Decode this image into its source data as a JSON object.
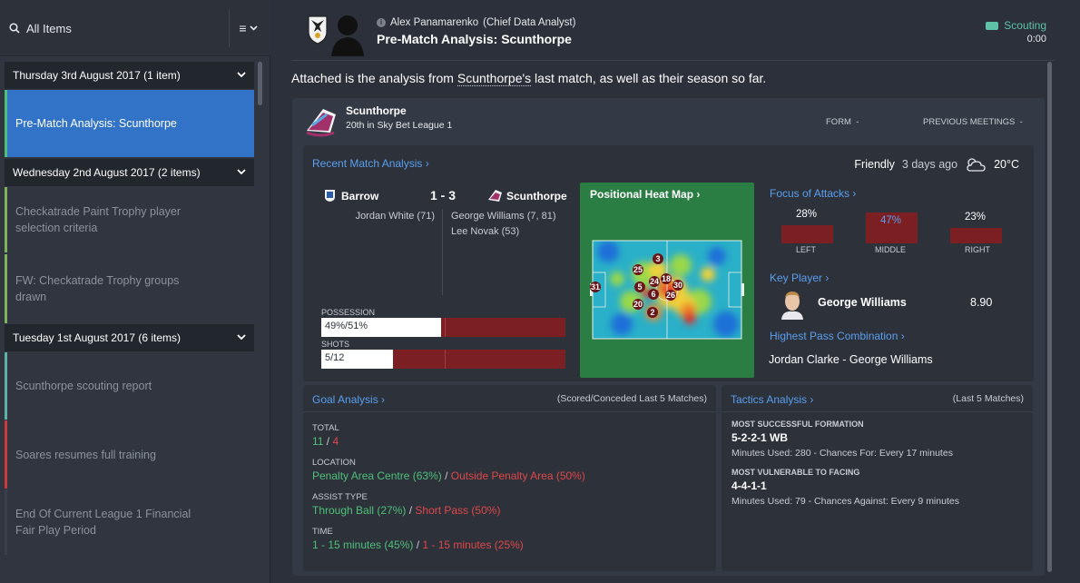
{
  "sidebar": {
    "search_label": "All Items",
    "groups": [
      {
        "label": "Thursday 3rd August 2017 (1 item)"
      },
      {
        "label": "Wednesday 2nd August 2017 (2 items)"
      },
      {
        "label": "Tuesday 1st August 2017 (6 items)"
      }
    ],
    "items": [
      {
        "label": "Pre-Match Analysis: Scunthorpe"
      },
      {
        "label": "Checkatrade Paint Trophy player selection criteria"
      },
      {
        "label": "FW: Checkatrade Trophy groups drawn"
      },
      {
        "label": "Scunthorpe scouting report"
      },
      {
        "label": "Soares resumes full training"
      },
      {
        "label": "End Of Current League 1 Financial Fair Play Period"
      }
    ]
  },
  "message": {
    "sender": "Alex Panamarenko",
    "sender_role": "(Chief Data Analyst)",
    "subject": "Pre-Match Analysis: Scunthorpe",
    "tag": "Scouting",
    "time": "0:00",
    "intro_before": "Attached is the analysis from ",
    "intro_link": "Scunthorpe's",
    "intro_after": " last match, as well as their season so far."
  },
  "team": {
    "name": "Scunthorpe",
    "position": "20th in Sky Bet League 1",
    "form_label": "FORM",
    "form_value": "-",
    "prev_label": "PREVIOUS MEETINGS",
    "prev_value": "-"
  },
  "recent_match": {
    "title": "Recent Match Analysis ›",
    "competition": "Friendly",
    "when": "3 days ago",
    "temperature": "20°C",
    "home_team": "Barrow",
    "score": "1 - 3",
    "away_team": "Scunthorpe",
    "home_scorers": [
      "Jordan White (71)"
    ],
    "away_scorers": [
      "George Williams (7, 81)",
      "Lee Novak (53)"
    ],
    "possession_label": "POSSESSION",
    "possession_text": "49%/51%",
    "possession_home_pct": 49,
    "shots_label": "SHOTS",
    "shots_text": "5/12",
    "shots_home": 5,
    "shots_away": 12
  },
  "heat_map": {
    "title": "Positional Heat Map ›",
    "players": [
      "3",
      "25",
      "18",
      "24",
      "30",
      "5",
      "31",
      "6",
      "26",
      "20",
      "2"
    ]
  },
  "focus_of_attacks": {
    "title": "Focus of Attacks ›",
    "zones": [
      {
        "label": "LEFT",
        "value": "28%",
        "pct": 28
      },
      {
        "label": "MIDDLE",
        "value": "47%",
        "pct": 47
      },
      {
        "label": "RIGHT",
        "value": "23%",
        "pct": 23
      }
    ]
  },
  "key_player": {
    "title": "Key Player ›",
    "name": "George Williams",
    "rating": "8.90"
  },
  "pass_combo": {
    "title": "Highest Pass Combination ›",
    "value": "Jordan Clarke - George Williams"
  },
  "goal_analysis": {
    "title": "Goal Analysis ›",
    "note": "(Scored/Conceded Last 5 Matches)",
    "total_label": "TOTAL",
    "total_scored": "11",
    "total_conceded": "4",
    "location_label": "LOCATION",
    "location_scored": "Penalty Area Centre (63%)",
    "location_conceded": "Outside Penalty Area (50%)",
    "assist_label": "ASSIST TYPE",
    "assist_scored": "Through Ball (27%)",
    "assist_conceded": "Short Pass (50%)",
    "time_label": "TIME",
    "time_scored": "1 - 15 minutes (45%)",
    "time_conceded": "1 - 15 minutes (25%)"
  },
  "tactics": {
    "title": "Tactics Analysis ›",
    "note": "(Last 5 Matches)",
    "success_label": "MOST SUCCESSFUL FORMATION",
    "success_formation": "5-2-2-1 WB",
    "success_detail": "Minutes Used: 280 - Chances For: Every 17 minutes",
    "vulnerable_label": "MOST VULNERABLE TO FACING",
    "vulnerable_formation": "4-4-1-1",
    "vulnerable_detail": "Minutes Used: 79 - Chances Against: Every 9 minutes"
  },
  "colors": {
    "accent": "#3273c8",
    "link": "#5b9ff0",
    "scored": "#4fc07a",
    "conceded": "#e0484a",
    "tag": "#5fc2a8",
    "bar_red": "#7c1f22"
  }
}
